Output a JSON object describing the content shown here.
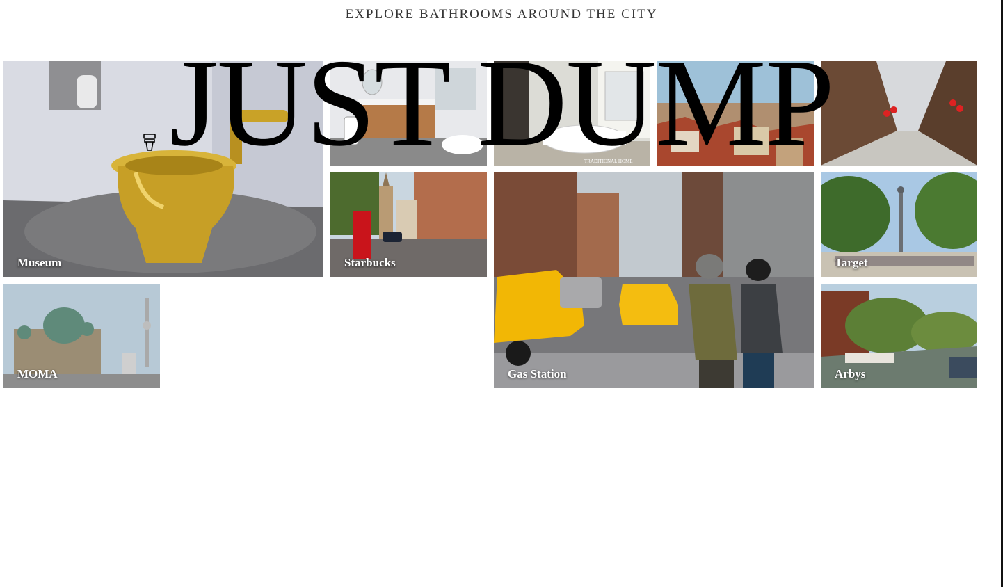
{
  "header": {
    "tagline": "EXPLORE BATHROOMS AROUND THE CITY",
    "title": "JUST DUMP",
    "logo_icon": "toilet-icon"
  },
  "tiles": [
    {
      "label": "Museum"
    },
    {
      "label": "Starbucks"
    },
    {
      "label": "Target"
    },
    {
      "label": "MOMA"
    },
    {
      "label": "Gas Station"
    },
    {
      "label": "Arbys"
    }
  ],
  "image_watermark": "TRADITIONAL HOME",
  "colors": {
    "taxi_yellow": "#f2b705",
    "gold": "#c9a227",
    "text": "#000000"
  }
}
